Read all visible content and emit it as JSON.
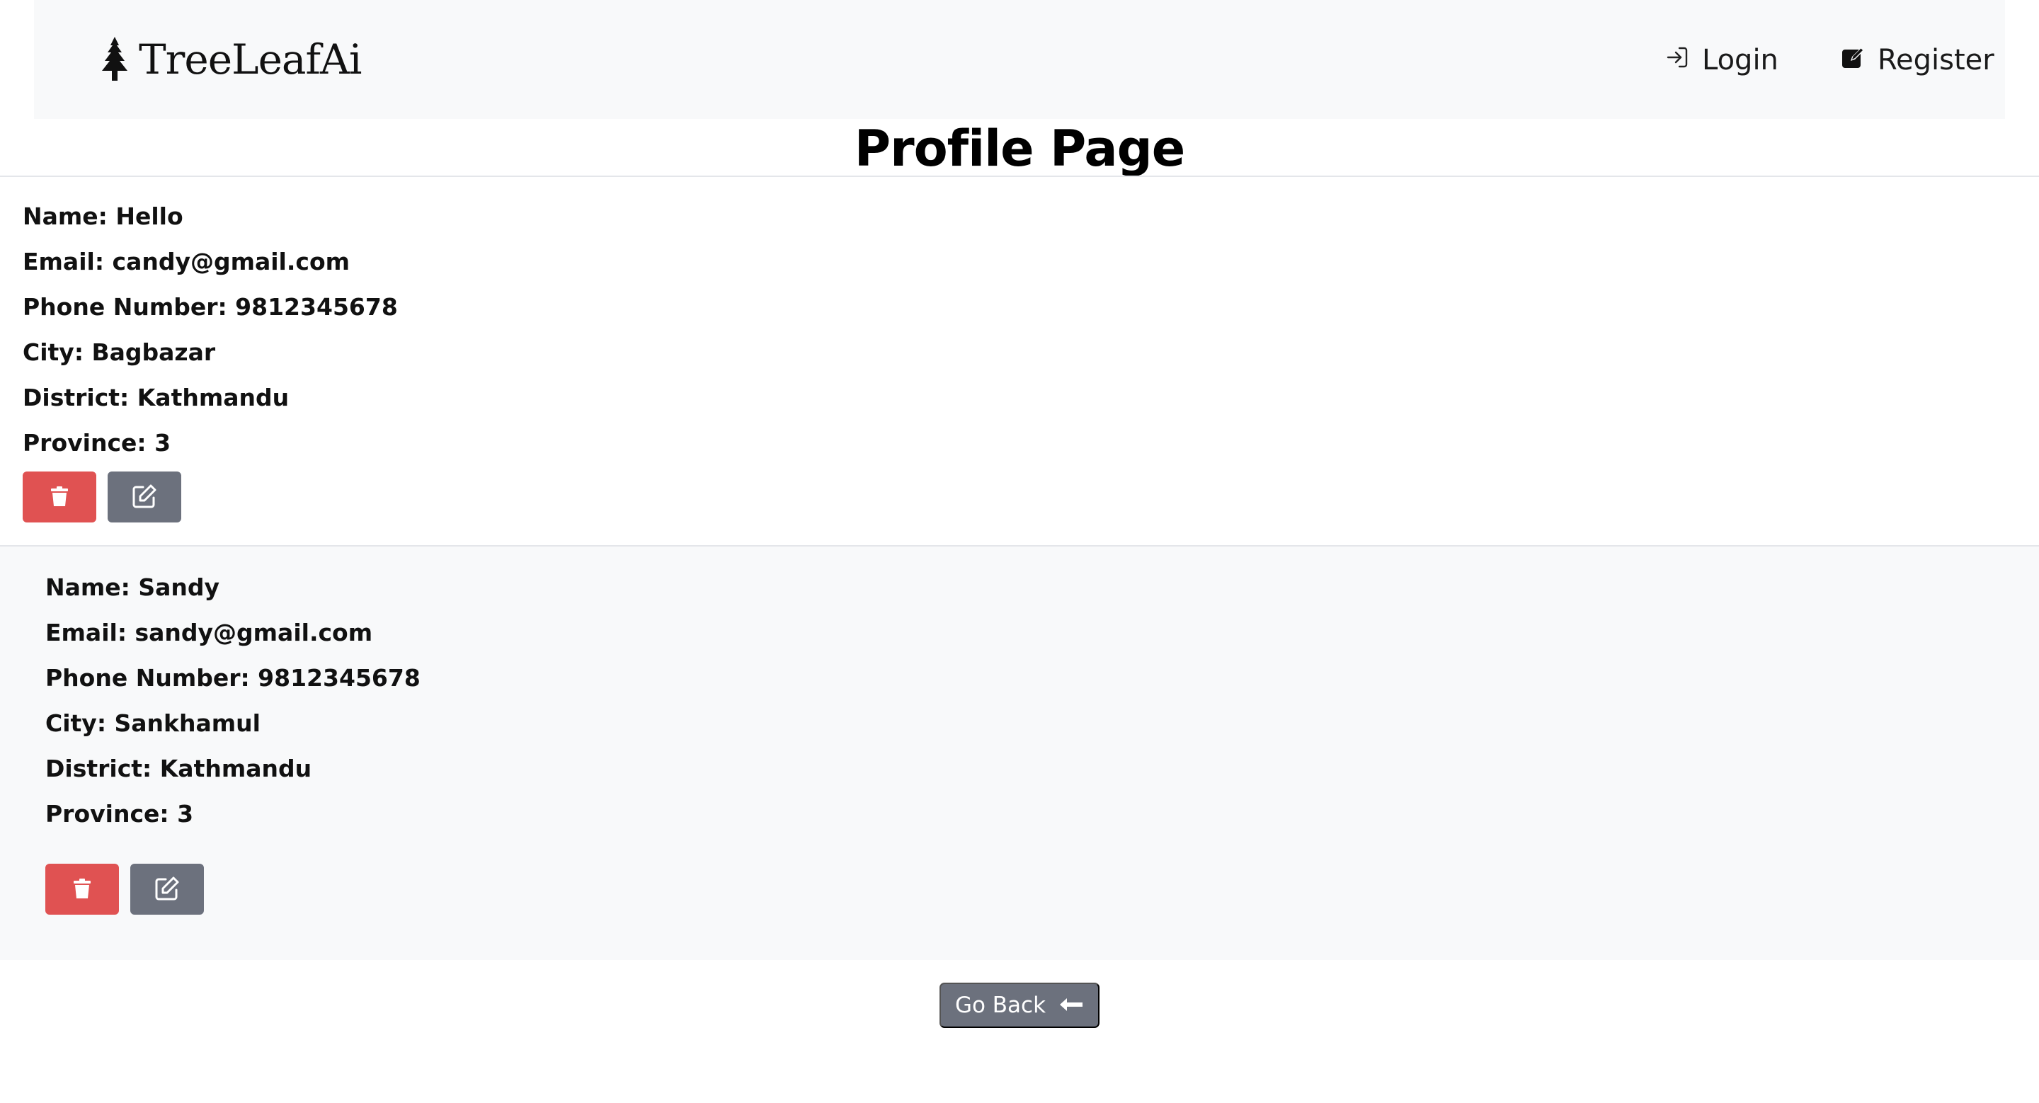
{
  "navbar": {
    "brand_name": "TreeLeafAi",
    "brand_icon": "tree-icon",
    "links": [
      {
        "label": "Login",
        "icon": "login-icon"
      },
      {
        "label": "Register",
        "icon": "edit-square-icon"
      }
    ]
  },
  "page": {
    "title": "Profile Page"
  },
  "profiles": [
    {
      "name": "Name: Hello",
      "email": "Email: candy@gmail.com",
      "phone": "Phone Number: 9812345678",
      "city": "City: Bagbazar",
      "district": "District: Kathmandu",
      "province": "Province: 3",
      "actions": [
        "trash-icon",
        "edit-icon"
      ]
    },
    {
      "name": "Name: Sandy",
      "email": "Email: sandy@gmail.com",
      "phone": "Phone Number: 9812345678",
      "city": "City: Sankhamul",
      "district": "District: Kathmandu",
      "province": "Province: 3",
      "actions": [
        "trash-icon",
        "edit-icon"
      ]
    }
  ],
  "footer": {
    "go_back_label": "Go Back",
    "go_back_icon": "arrow-left-icon"
  },
  "colors": {
    "navbar_bg": "#f8f9fa",
    "delete_button": "#e05252",
    "secondary_button": "#6c717d",
    "alt_card_bg": "#f8f9fa"
  }
}
